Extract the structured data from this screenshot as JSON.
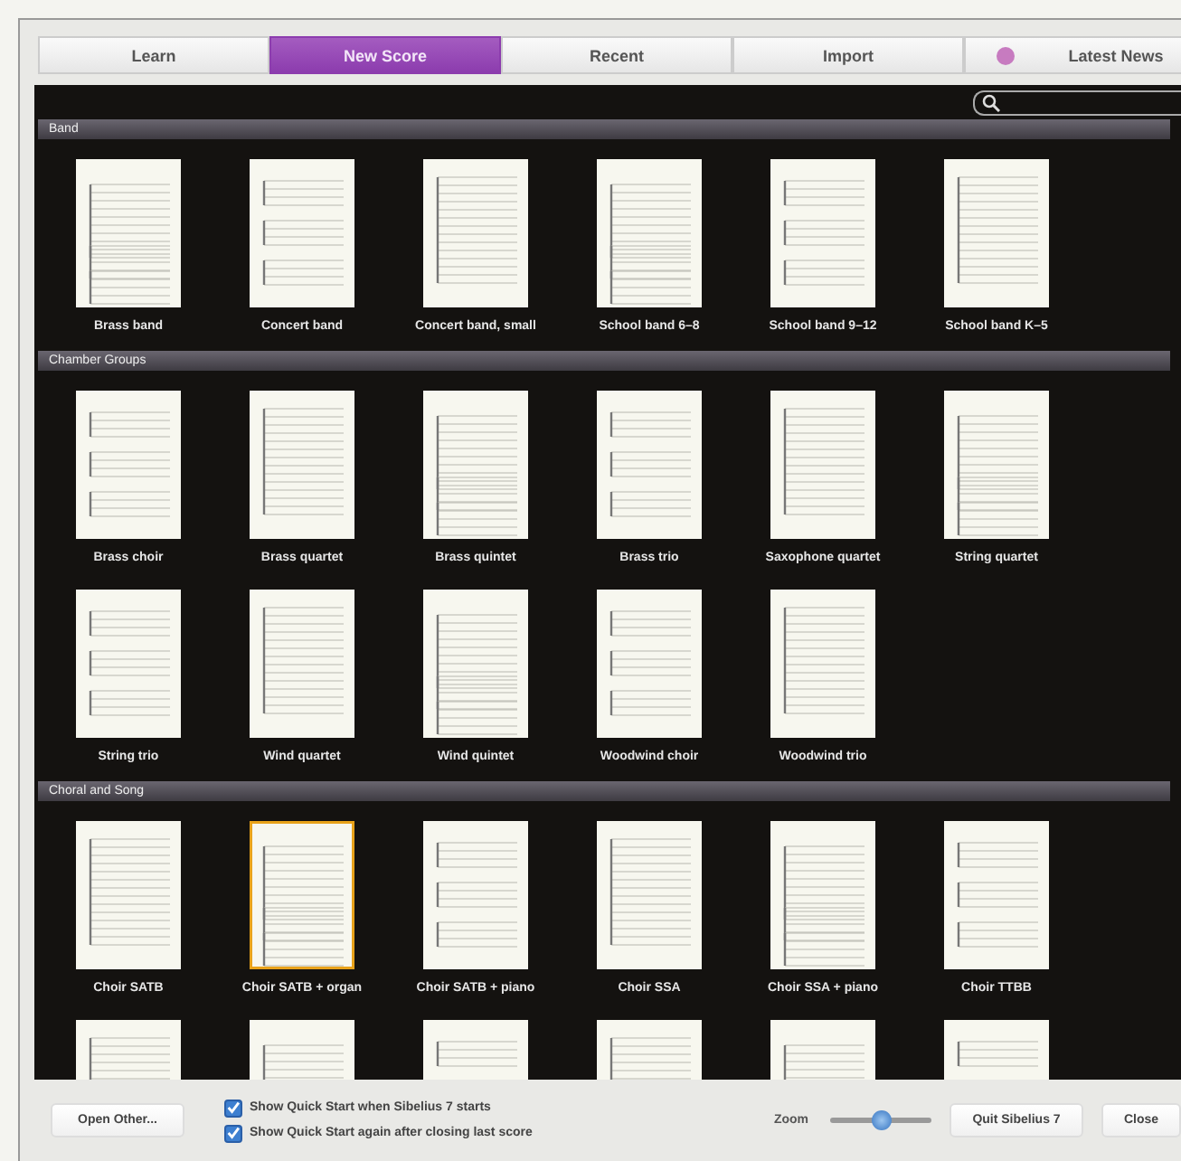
{
  "tabs": [
    {
      "label": "Learn",
      "selected": false
    },
    {
      "label": "New Score",
      "selected": true
    },
    {
      "label": "Recent",
      "selected": false
    },
    {
      "label": "Import",
      "selected": false
    },
    {
      "label": "Latest News",
      "selected": false,
      "color": "#c77bc0"
    }
  ],
  "search": {
    "kind": "field"
  },
  "sections": [
    {
      "title": "Band",
      "items": [
        {
          "kind": "template",
          "label": "Brass band",
          "selected": false
        },
        {
          "kind": "template",
          "label": "Concert band",
          "selected": false
        },
        {
          "kind": "template",
          "label": "Concert band, small",
          "selected": false
        },
        {
          "kind": "template",
          "label": "School band 6–8",
          "selected": false
        },
        {
          "kind": "template",
          "label": "School band 9–12",
          "selected": false
        },
        {
          "kind": "template",
          "label": "School band K–5",
          "selected": false
        }
      ]
    },
    {
      "title": "Chamber Groups",
      "items": [
        {
          "kind": "template",
          "label": "Brass choir",
          "selected": false
        },
        {
          "kind": "template",
          "label": "Brass quartet",
          "selected": false
        },
        {
          "kind": "template",
          "label": "Brass quintet",
          "selected": false
        },
        {
          "kind": "template",
          "label": "Brass trio",
          "selected": false
        },
        {
          "kind": "template",
          "label": "Saxophone quartet",
          "selected": false
        },
        {
          "kind": "template",
          "label": "String quartet",
          "selected": false
        },
        {
          "kind": "template",
          "label": "String trio",
          "selected": false
        },
        {
          "kind": "template",
          "label": "Wind quartet",
          "selected": false
        },
        {
          "kind": "template",
          "label": "Wind quintet",
          "selected": false
        },
        {
          "kind": "template",
          "label": "Woodwind choir",
          "selected": false
        },
        {
          "kind": "template",
          "label": "Woodwind trio",
          "selected": false
        }
      ]
    },
    {
      "title": "Choral and Song",
      "items": [
        {
          "kind": "template",
          "label": "Choir SATB",
          "selected": false
        },
        {
          "kind": "template",
          "label": "Choir SATB + organ",
          "selected": true
        },
        {
          "kind": "template",
          "label": "Choir SATB + piano",
          "selected": false
        },
        {
          "kind": "template",
          "label": "Choir SSA",
          "selected": false
        },
        {
          "kind": "template",
          "label": "Choir SSA + piano",
          "selected": false
        },
        {
          "kind": "template",
          "label": "Choir TTBB",
          "selected": false
        },
        {
          "kind": "cut-off"
        },
        {
          "kind": "cut-off"
        },
        {
          "kind": "cut-off"
        },
        {
          "kind": "cut-off"
        },
        {
          "kind": "cut-off"
        },
        {
          "kind": "cut-off"
        }
      ]
    }
  ],
  "footer": {
    "open_button": "Open Other...",
    "checkboxes": [
      {
        "label": "Show Quick Start when Sibelius 7 starts",
        "checked": true
      },
      {
        "label": "Show Quick Start again after closing last score",
        "checked": true
      }
    ],
    "zoom_label": "Zoom",
    "zoom": {
      "level": 0.5
    },
    "quit_button": "Quit Sibelius 7",
    "close_button": "Close"
  }
}
